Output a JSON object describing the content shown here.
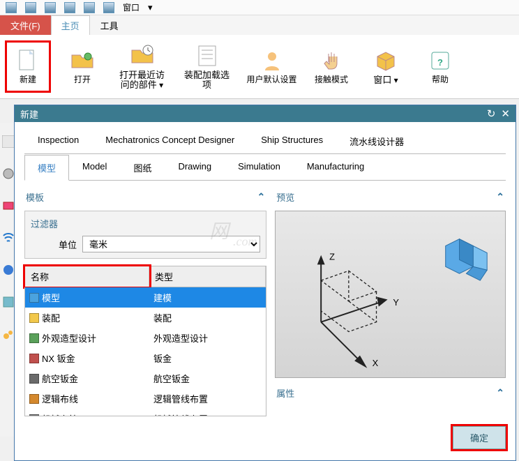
{
  "topstrip": {
    "window_label": "窗口"
  },
  "menutabs": {
    "file": "文件(F)",
    "home": "主页",
    "tools": "工具"
  },
  "ribbon": {
    "new": "新建",
    "open": "打开",
    "recent_line1": "打开最近访",
    "recent_line2": "问的部件",
    "assembly_line1": "装配加载选",
    "assembly_line2": "项",
    "userdef": "用户默认设置",
    "touch": "接触模式",
    "window": "窗口",
    "help": "帮助"
  },
  "dialog": {
    "title": "新建",
    "tabs1": [
      "Inspection",
      "Mechatronics Concept Designer",
      "Ship Structures",
      "流水线设计器"
    ],
    "tabs2": [
      "模型",
      "Model",
      "图纸",
      "Drawing",
      "Simulation",
      "Manufacturing"
    ],
    "active_tab2": "模型",
    "section_template": "模板",
    "section_preview": "预览",
    "section_attrs": "属性",
    "filter": {
      "header": "过滤器",
      "unit_label": "单位",
      "unit_value": "毫米"
    },
    "table": {
      "col_name": "名称",
      "col_type": "类型",
      "rows": [
        {
          "name": "模型",
          "type": "建模",
          "selected": true,
          "col": "#4aa3df"
        },
        {
          "name": "装配",
          "type": "装配",
          "selected": false,
          "col": "#f2c84b"
        },
        {
          "name": "外观造型设计",
          "type": "外观造型设计",
          "selected": false,
          "col": "#5aa05a"
        },
        {
          "name": "NX 钣金",
          "type": "钣金",
          "selected": false,
          "col": "#c0504d"
        },
        {
          "name": "航空钣金",
          "type": "航空钣金",
          "selected": false,
          "col": "#6a6a6a"
        },
        {
          "name": "逻辑布线",
          "type": "逻辑管线布置",
          "selected": false,
          "col": "#d4882d"
        },
        {
          "name": "机械布管",
          "type": "机械管线布置",
          "selected": false,
          "col": "#777"
        }
      ]
    },
    "axes": {
      "x": "X",
      "y": "Y",
      "z": "Z"
    },
    "ok": "确定"
  }
}
